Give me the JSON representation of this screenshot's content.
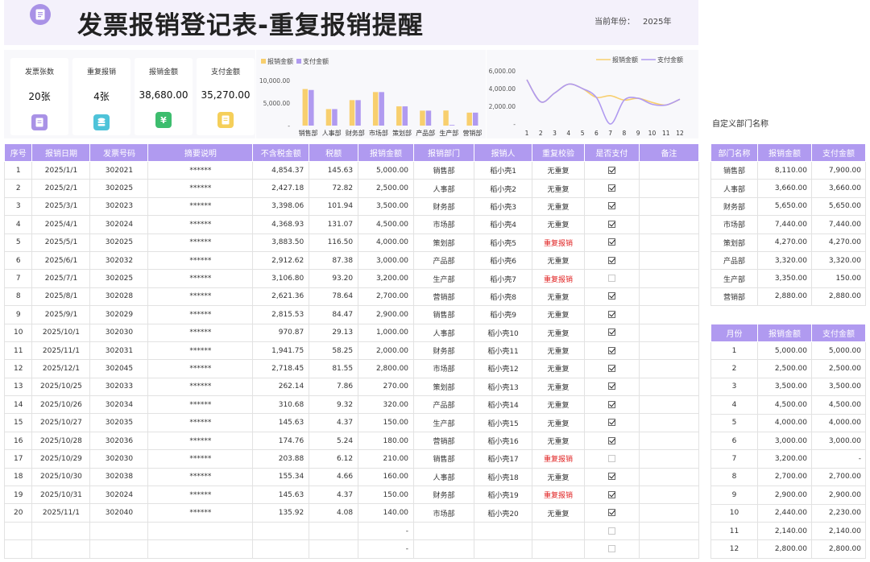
{
  "header": {
    "title": "发票报销登记表-重复报销提醒",
    "year_label": "当前年份：",
    "year_value": "2025年"
  },
  "stats": [
    {
      "label": "发票张数",
      "value": "20张",
      "icon": "document-icon",
      "color": "#a992e6"
    },
    {
      "label": "重复报销",
      "value": "4张",
      "icon": "database-icon",
      "color": "#4ec3d9"
    },
    {
      "label": "报销金额",
      "value": "38,680.00",
      "icon": "yuan-icon",
      "color": "#3dbd6e"
    },
    {
      "label": "支付金额",
      "value": "35,270.00",
      "icon": "note-icon",
      "color": "#f5cf5a"
    }
  ],
  "chart_data": [
    {
      "type": "bar",
      "categories": [
        "销售部",
        "人事部",
        "财务部",
        "市场部",
        "策划部",
        "产品部",
        "生产部",
        "营销部"
      ],
      "series": [
        {
          "name": "报销金额",
          "color": "#f8cf6e",
          "values": [
            8110,
            3660,
            5650,
            7440,
            4270,
            3320,
            3350,
            2880
          ]
        },
        {
          "name": "支付金额",
          "color": "#b09af0",
          "values": [
            7900,
            3660,
            5650,
            7440,
            4270,
            3320,
            150,
            2880
          ]
        }
      ],
      "ylim": [
        0,
        10000
      ],
      "yticks": [
        "10,000.00",
        "5,000.00",
        "-"
      ],
      "legend": "top-left"
    },
    {
      "type": "line",
      "categories": [
        "1",
        "2",
        "3",
        "4",
        "5",
        "6",
        "7",
        "8",
        "9",
        "10",
        "11",
        "12"
      ],
      "series": [
        {
          "name": "报销金额",
          "color": "#f8cf6e",
          "values": [
            5000,
            2500,
            3500,
            4500,
            4000,
            3000,
            3200,
            2700,
            2900,
            2440,
            2140,
            2800
          ]
        },
        {
          "name": "支付金额",
          "color": "#b09af0",
          "values": [
            5000,
            2500,
            3500,
            4500,
            4000,
            3000,
            0,
            2700,
            2900,
            2230,
            2140,
            2800
          ]
        }
      ],
      "ylim": [
        0,
        6000
      ],
      "yticks": [
        "6,000.00",
        "4,000.00",
        "2,000.00",
        "-"
      ],
      "legend": "top-right"
    }
  ],
  "main_table": {
    "headers": [
      "序号",
      "报销日期",
      "发票号码",
      "摘要说明",
      "不含税金额",
      "税额",
      "报销金额",
      "报销部门",
      "报销人",
      "重复校验",
      "是否支付",
      "备注"
    ],
    "rows": [
      [
        "1",
        "2025/1/1",
        "302021",
        "******",
        "4,854.37",
        "145.63",
        "5,000.00",
        "销售部",
        "稻小壳1",
        "无重复",
        true,
        ""
      ],
      [
        "2",
        "2025/2/1",
        "302025",
        "******",
        "2,427.18",
        "72.82",
        "2,500.00",
        "人事部",
        "稻小壳2",
        "无重复",
        true,
        ""
      ],
      [
        "3",
        "2025/3/1",
        "302023",
        "******",
        "3,398.06",
        "101.94",
        "3,500.00",
        "财务部",
        "稻小壳3",
        "无重复",
        true,
        ""
      ],
      [
        "4",
        "2025/4/1",
        "302024",
        "******",
        "4,368.93",
        "131.07",
        "4,500.00",
        "市场部",
        "稻小壳4",
        "无重复",
        true,
        ""
      ],
      [
        "5",
        "2025/5/1",
        "302025",
        "******",
        "3,883.50",
        "116.50",
        "4,000.00",
        "策划部",
        "稻小壳5",
        "重复报销",
        true,
        ""
      ],
      [
        "6",
        "2025/6/1",
        "302032",
        "******",
        "2,912.62",
        "87.38",
        "3,000.00",
        "产品部",
        "稻小壳6",
        "无重复",
        true,
        ""
      ],
      [
        "7",
        "2025/7/1",
        "302025",
        "******",
        "3,106.80",
        "93.20",
        "3,200.00",
        "生产部",
        "稻小壳7",
        "重复报销",
        false,
        ""
      ],
      [
        "8",
        "2025/8/1",
        "302028",
        "******",
        "2,621.36",
        "78.64",
        "2,700.00",
        "营销部",
        "稻小壳8",
        "无重复",
        true,
        ""
      ],
      [
        "9",
        "2025/9/1",
        "302029",
        "******",
        "2,815.53",
        "84.47",
        "2,900.00",
        "销售部",
        "稻小壳9",
        "无重复",
        true,
        ""
      ],
      [
        "10",
        "2025/10/1",
        "302030",
        "******",
        "970.87",
        "29.13",
        "1,000.00",
        "人事部",
        "稻小壳10",
        "无重复",
        true,
        ""
      ],
      [
        "11",
        "2025/11/1",
        "302031",
        "******",
        "1,941.75",
        "58.25",
        "2,000.00",
        "财务部",
        "稻小壳11",
        "无重复",
        true,
        ""
      ],
      [
        "12",
        "2025/12/1",
        "302045",
        "******",
        "2,718.45",
        "81.55",
        "2,800.00",
        "市场部",
        "稻小壳12",
        "无重复",
        true,
        ""
      ],
      [
        "13",
        "2025/10/25",
        "302033",
        "******",
        "262.14",
        "7.86",
        "270.00",
        "策划部",
        "稻小壳13",
        "无重复",
        true,
        ""
      ],
      [
        "14",
        "2025/10/26",
        "302034",
        "******",
        "310.68",
        "9.32",
        "320.00",
        "产品部",
        "稻小壳14",
        "无重复",
        true,
        ""
      ],
      [
        "15",
        "2025/10/27",
        "302035",
        "******",
        "145.63",
        "4.37",
        "150.00",
        "生产部",
        "稻小壳15",
        "无重复",
        true,
        ""
      ],
      [
        "16",
        "2025/10/28",
        "302036",
        "******",
        "174.76",
        "5.24",
        "180.00",
        "营销部",
        "稻小壳16",
        "无重复",
        true,
        ""
      ],
      [
        "17",
        "2025/10/29",
        "302030",
        "******",
        "203.88",
        "6.12",
        "210.00",
        "销售部",
        "稻小壳17",
        "重复报销",
        false,
        ""
      ],
      [
        "18",
        "2025/10/30",
        "302038",
        "******",
        "155.34",
        "4.66",
        "160.00",
        "人事部",
        "稻小壳18",
        "无重复",
        true,
        ""
      ],
      [
        "19",
        "2025/10/31",
        "302024",
        "******",
        "145.63",
        "4.37",
        "150.00",
        "财务部",
        "稻小壳19",
        "重复报销",
        true,
        ""
      ],
      [
        "20",
        "2025/11/1",
        "302040",
        "******",
        "135.92",
        "4.08",
        "140.00",
        "市场部",
        "稻小壳20",
        "无重复",
        true,
        ""
      ],
      [
        "",
        "",
        "",
        "",
        "",
        "",
        "-",
        "",
        "",
        "",
        false,
        ""
      ],
      [
        "",
        "",
        "",
        "",
        "",
        "",
        "-",
        "",
        "",
        "",
        false,
        ""
      ]
    ]
  },
  "side": {
    "title": "自定义部门名称",
    "dept_headers": [
      "部门名称",
      "报销金额",
      "支付金额"
    ],
    "dept_rows": [
      [
        "销售部",
        "8,110.00",
        "7,900.00"
      ],
      [
        "人事部",
        "3,660.00",
        "3,660.00"
      ],
      [
        "财务部",
        "5,650.00",
        "5,650.00"
      ],
      [
        "市场部",
        "7,440.00",
        "7,440.00"
      ],
      [
        "策划部",
        "4,270.00",
        "4,270.00"
      ],
      [
        "产品部",
        "3,320.00",
        "3,320.00"
      ],
      [
        "生产部",
        "3,350.00",
        "150.00"
      ],
      [
        "营销部",
        "2,880.00",
        "2,880.00"
      ]
    ],
    "month_headers": [
      "月份",
      "报销金额",
      "支付金额"
    ],
    "month_rows": [
      [
        "1",
        "5,000.00",
        "5,000.00"
      ],
      [
        "2",
        "2,500.00",
        "2,500.00"
      ],
      [
        "3",
        "3,500.00",
        "3,500.00"
      ],
      [
        "4",
        "4,500.00",
        "4,500.00"
      ],
      [
        "5",
        "4,000.00",
        "4,000.00"
      ],
      [
        "6",
        "3,000.00",
        "3,000.00"
      ],
      [
        "7",
        "3,200.00",
        "-"
      ],
      [
        "8",
        "2,700.00",
        "2,700.00"
      ],
      [
        "9",
        "2,900.00",
        "2,900.00"
      ],
      [
        "10",
        "2,440.00",
        "2,230.00"
      ],
      [
        "11",
        "2,140.00",
        "2,140.00"
      ],
      [
        "12",
        "2,800.00",
        "2,800.00"
      ]
    ]
  },
  "colors": {
    "accent": "#b09af0",
    "duplicate": "#e02020",
    "bar_a": "#f8cf6e",
    "bar_b": "#b09af0"
  }
}
